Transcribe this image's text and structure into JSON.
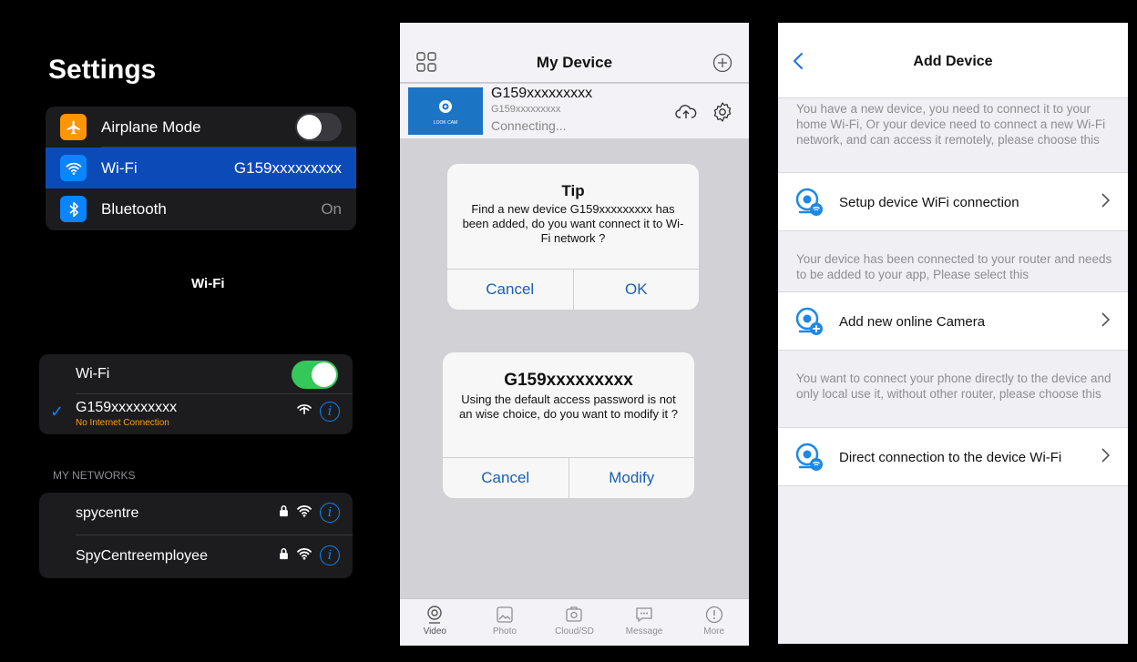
{
  "settings": {
    "title": "Settings",
    "rows": [
      {
        "label": "Airplane Mode",
        "toggle": "off"
      },
      {
        "label": "Wi-Fi",
        "value": "G159xxxxxxxxx"
      },
      {
        "label": "Bluetooth",
        "value": "On"
      }
    ],
    "wifi_heading": "Wi-Fi",
    "wifi_toggle_label": "Wi-Fi",
    "wifi_toggle": "on",
    "connected_network": {
      "name": "G159xxxxxxxxx",
      "status": "No Internet Connection"
    },
    "my_networks_label": "MY NETWORKS",
    "networks": [
      {
        "name": "spycentre"
      },
      {
        "name": "SpyCentreemployee"
      }
    ],
    "colors": {
      "accent": "#0a84ff",
      "selected": "#0a4bb8",
      "toggle_on": "#34c759",
      "warning": "#ff9f0a"
    }
  },
  "my_device": {
    "title": "My Device",
    "device": {
      "name": "G159xxxxxxxxx",
      "id": "G159xxxxxxxxx",
      "status": "Connecting...",
      "thumb_text": "LOOK CAM"
    },
    "tip_dialog": {
      "title": "Tip",
      "message": "Find a new device G159xxxxxxxxx has been added, do you want connect it to Wi-Fi network ?",
      "cancel": "Cancel",
      "ok": "OK"
    },
    "password_dialog": {
      "title": "G159xxxxxxxxx",
      "message": "Using the default access password is not an wise choice, do you want to modify it ?",
      "cancel": "Cancel",
      "modify": "Modify"
    },
    "tabs": [
      {
        "label": "Video",
        "icon": "video-icon"
      },
      {
        "label": "Photo",
        "icon": "photo-icon"
      },
      {
        "label": "Cloud/SD",
        "icon": "cloud-sd-icon"
      },
      {
        "label": "Message",
        "icon": "message-icon"
      },
      {
        "label": "More",
        "icon": "more-icon"
      }
    ]
  },
  "add_device": {
    "title": "Add Device",
    "sections": [
      {
        "description": "You have a new device, you need to connect it to your home Wi-Fi, Or your device need to connect a new Wi-Fi network, and can access it remotely, please choose this",
        "option": "Setup device WiFi connection"
      },
      {
        "description": "Your device has been connected to your router and needs to be added to your app, Please select this",
        "option": "Add new online Camera"
      },
      {
        "description": "You want to connect your phone directly to the device and only local use it, without other router, please choose this",
        "option": "Direct connection to the device Wi-Fi"
      }
    ],
    "colors": {
      "icon_blue": "#1e88e5"
    }
  }
}
